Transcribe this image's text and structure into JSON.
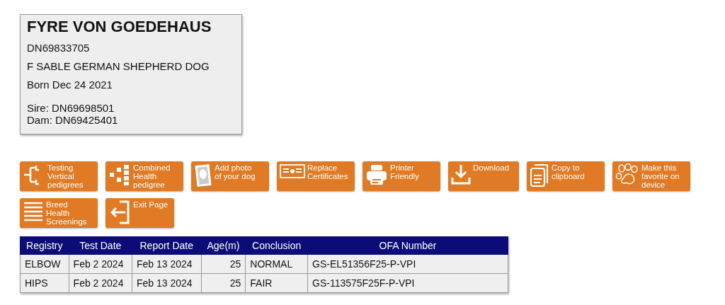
{
  "dog": {
    "name": "FYRE VON GOEDEHAUS",
    "registration": "DN69833705",
    "description": "F SABLE GERMAN SHEPHERD DOG",
    "born": "Born Dec 24 2021",
    "sire": "Sire: DN69698501",
    "dam": "Dam: DN69425401"
  },
  "actions": [
    {
      "kind": "pedigree",
      "label": "Testing\nVertical\npedigrees"
    },
    {
      "kind": "health",
      "label": "Combined\nHealth\npedigree"
    },
    {
      "kind": "photo",
      "label": "Add photo\nof your dog"
    },
    {
      "kind": "certificate",
      "label": "Replace\nCertificates"
    },
    {
      "kind": "printer",
      "label": "Printer\nFriendly"
    },
    {
      "kind": "download",
      "label": "Download"
    },
    {
      "kind": "clipboard",
      "label": "Copy to\nclipboard"
    },
    {
      "kind": "paw",
      "label": "Make this\nfavorite on\ndevice"
    },
    {
      "kind": "list",
      "label": "Breed\nHealth\nScreenings"
    },
    {
      "kind": "exit",
      "label": "Exit Page"
    }
  ],
  "table": {
    "columns": [
      "Registry",
      "Test Date",
      "Report Date",
      "Age(m)",
      "Conclusion",
      "OFA Number"
    ],
    "rows": [
      [
        "ELBOW",
        "Feb 2 2024",
        "Feb 13 2024",
        "25",
        "NORMAL",
        "GS-EL51356F25-P-VPI"
      ],
      [
        "HIPS",
        "Feb 2 2024",
        "Feb 13 2024",
        "25",
        "FAIR",
        "GS-113575F25F-P-VPI"
      ]
    ]
  }
}
